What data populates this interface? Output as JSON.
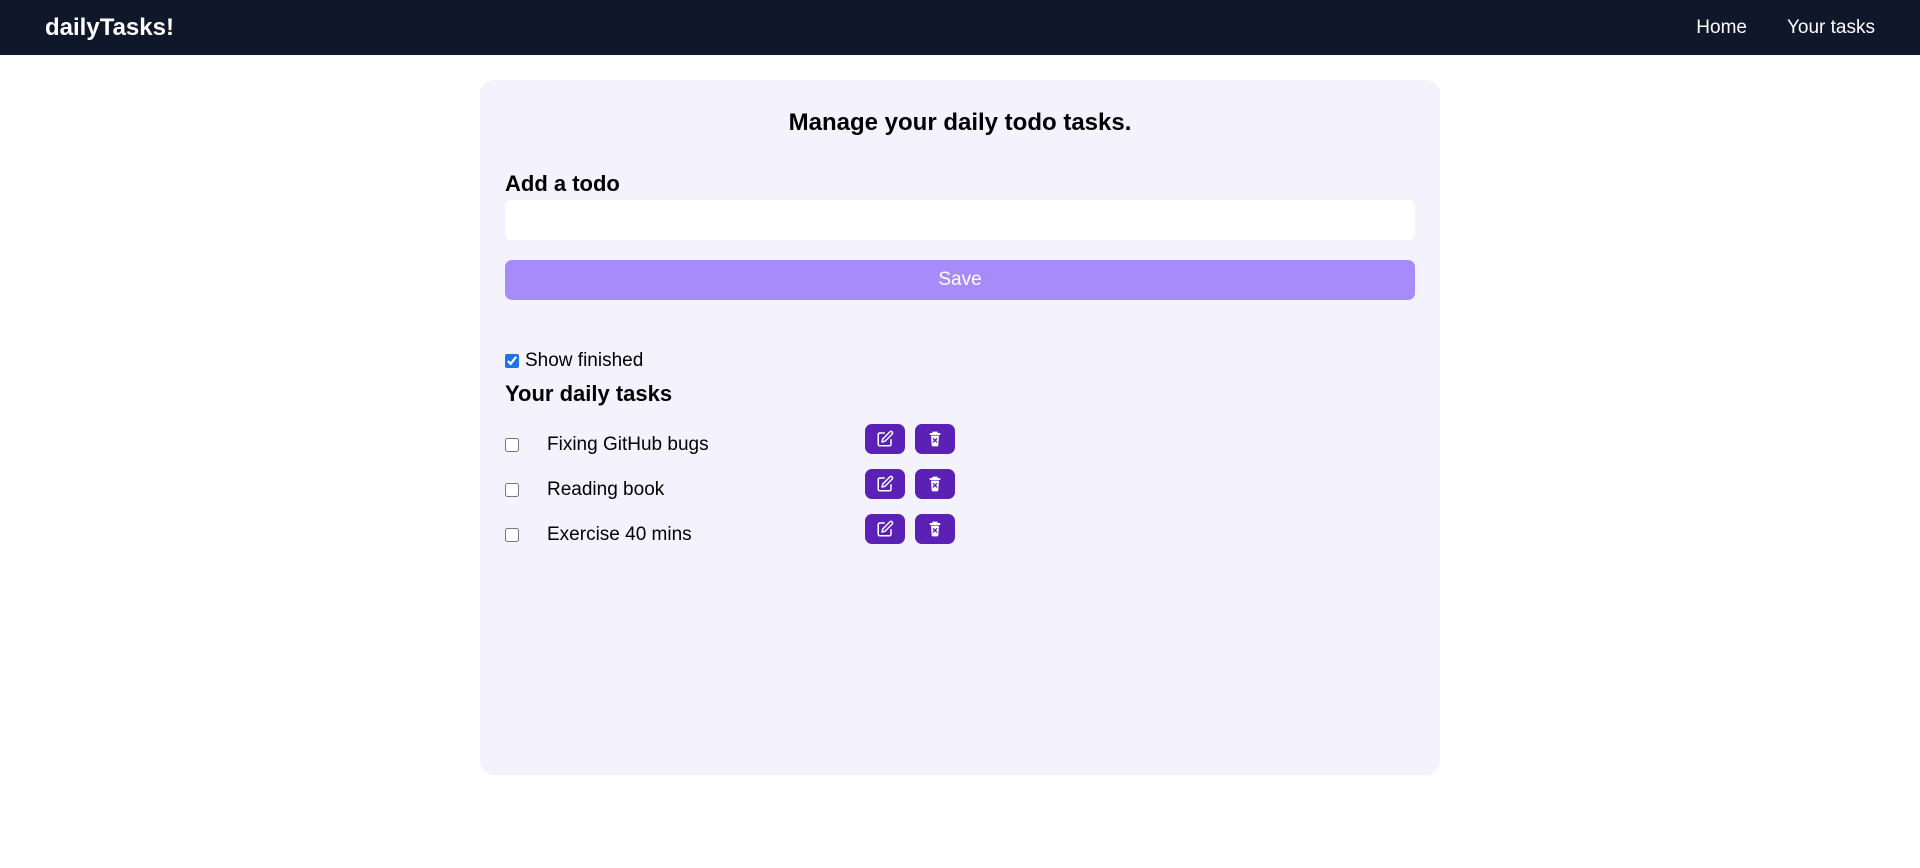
{
  "navbar": {
    "brand": "dailyTasks!",
    "links": [
      "Home",
      "Your tasks"
    ]
  },
  "main": {
    "title": "Manage your daily todo tasks.",
    "add_label": "Add a todo",
    "input_value": "",
    "save_label": "Save",
    "show_finished_label": "Show finished",
    "show_finished_checked": true,
    "tasks_heading": "Your daily tasks",
    "tasks": [
      {
        "text": "Fixing GitHub bugs",
        "done": false
      },
      {
        "text": "Reading book",
        "done": false
      },
      {
        "text": "Exercise 40 mins",
        "done": false
      }
    ]
  },
  "colors": {
    "navbar_bg": "#0f172a",
    "card_bg": "#f3f2fd",
    "save_button": "#a78bfa",
    "action_button": "#5b21b6"
  },
  "icons": {
    "edit": "edit-icon",
    "delete": "delete-icon"
  }
}
